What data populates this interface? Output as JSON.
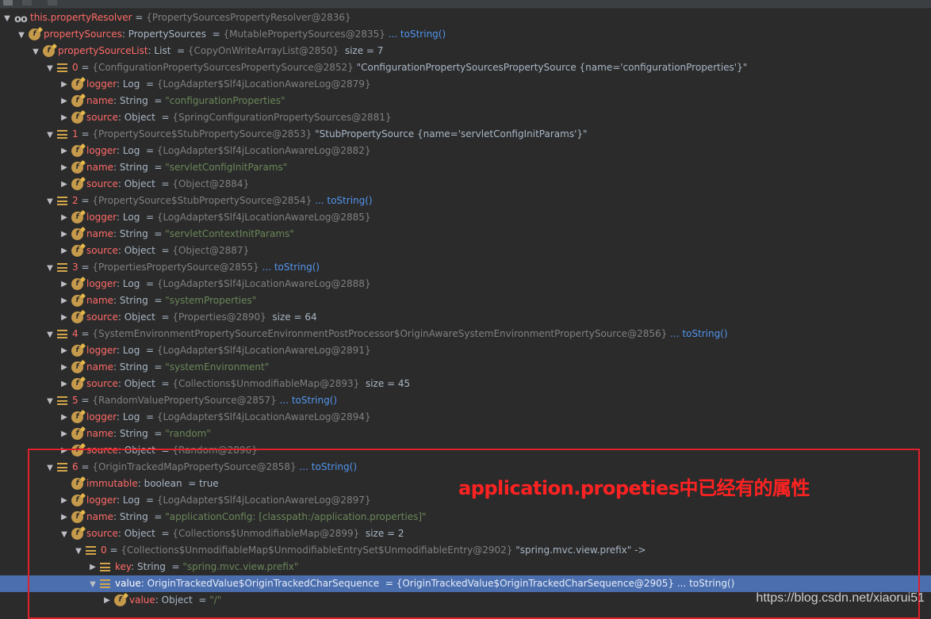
{
  "rows": [
    {
      "depth": 0,
      "tw": "exp",
      "icon": "oo",
      "name": "this.propertyResolver",
      "sep": " = ",
      "meta": "{PropertySourcesPropertyResolver@2836}"
    },
    {
      "depth": 1,
      "tw": "exp",
      "icon": "f",
      "name": "propertySources",
      "type": ": PropertySources ",
      "sep": " = ",
      "meta": "{MutablePropertySources@2835}",
      "tostr": " ... toString()"
    },
    {
      "depth": 2,
      "tw": "exp",
      "icon": "f",
      "name": "propertySourceList",
      "type": ": List ",
      "sep": " = ",
      "meta": "{CopyOnWriteArrayList@2850}",
      "extra": "  size = 7"
    },
    {
      "depth": 3,
      "tw": "exp",
      "icon": "list",
      "name": "0",
      "sep": " = ",
      "meta": "{ConfigurationPropertySourcesPropertySource@2852}",
      "extra": " \"ConfigurationPropertySourcesPropertySource {name='configurationProperties'}\""
    },
    {
      "depth": 4,
      "tw": "col",
      "icon": "f",
      "name": "logger",
      "type": ": Log ",
      "sep": " = ",
      "meta": "{LogAdapter$Slf4jLocationAwareLog@2879}"
    },
    {
      "depth": 4,
      "tw": "col",
      "icon": "f",
      "name": "name",
      "type": ": String ",
      "sep": " = ",
      "str": "\"configurationProperties\""
    },
    {
      "depth": 4,
      "tw": "col",
      "icon": "f",
      "name": "source",
      "type": ": Object ",
      "sep": " = ",
      "meta": "{SpringConfigurationPropertySources@2881}"
    },
    {
      "depth": 3,
      "tw": "exp",
      "icon": "list",
      "name": "1",
      "sep": " = ",
      "meta": "{PropertySource$StubPropertySource@2853}",
      "extra": " \"StubPropertySource {name='servletConfigInitParams'}\""
    },
    {
      "depth": 4,
      "tw": "col",
      "icon": "f",
      "name": "logger",
      "type": ": Log ",
      "sep": " = ",
      "meta": "{LogAdapter$Slf4jLocationAwareLog@2882}"
    },
    {
      "depth": 4,
      "tw": "col",
      "icon": "f",
      "name": "name",
      "type": ": String ",
      "sep": " = ",
      "str": "\"servletConfigInitParams\""
    },
    {
      "depth": 4,
      "tw": "col",
      "icon": "f",
      "name": "source",
      "type": ": Object ",
      "sep": " = ",
      "meta": "{Object@2884}"
    },
    {
      "depth": 3,
      "tw": "exp",
      "icon": "list",
      "name": "2",
      "sep": " = ",
      "meta": "{PropertySource$StubPropertySource@2854}",
      "tostr": " ... toString()"
    },
    {
      "depth": 4,
      "tw": "col",
      "icon": "f",
      "name": "logger",
      "type": ": Log ",
      "sep": " = ",
      "meta": "{LogAdapter$Slf4jLocationAwareLog@2885}"
    },
    {
      "depth": 4,
      "tw": "col",
      "icon": "f",
      "name": "name",
      "type": ": String ",
      "sep": " = ",
      "str": "\"servletContextInitParams\""
    },
    {
      "depth": 4,
      "tw": "col",
      "icon": "f",
      "name": "source",
      "type": ": Object ",
      "sep": " = ",
      "meta": "{Object@2887}"
    },
    {
      "depth": 3,
      "tw": "exp",
      "icon": "list",
      "name": "3",
      "sep": " = ",
      "meta": "{PropertiesPropertySource@2855}",
      "tostr": " ... toString()"
    },
    {
      "depth": 4,
      "tw": "col",
      "icon": "f",
      "name": "logger",
      "type": ": Log ",
      "sep": " = ",
      "meta": "{LogAdapter$Slf4jLocationAwareLog@2888}"
    },
    {
      "depth": 4,
      "tw": "col",
      "icon": "f",
      "name": "name",
      "type": ": String ",
      "sep": " = ",
      "str": "\"systemProperties\""
    },
    {
      "depth": 4,
      "tw": "col",
      "icon": "f",
      "name": "source",
      "type": ": Object ",
      "sep": " = ",
      "meta": "{Properties@2890}",
      "extra": "  size = 64"
    },
    {
      "depth": 3,
      "tw": "exp",
      "icon": "list",
      "name": "4",
      "sep": " = ",
      "meta": "{SystemEnvironmentPropertySourceEnvironmentPostProcessor$OriginAwareSystemEnvironmentPropertySource@2856}",
      "tostr": " ... toString()"
    },
    {
      "depth": 4,
      "tw": "col",
      "icon": "f",
      "name": "logger",
      "type": ": Log ",
      "sep": " = ",
      "meta": "{LogAdapter$Slf4jLocationAwareLog@2891}"
    },
    {
      "depth": 4,
      "tw": "col",
      "icon": "f",
      "name": "name",
      "type": ": String ",
      "sep": " = ",
      "str": "\"systemEnvironment\""
    },
    {
      "depth": 4,
      "tw": "col",
      "icon": "f",
      "name": "source",
      "type": ": Object ",
      "sep": " = ",
      "meta": "{Collections$UnmodifiableMap@2893}",
      "extra": "  size = 45"
    },
    {
      "depth": 3,
      "tw": "exp",
      "icon": "list",
      "name": "5",
      "sep": " = ",
      "meta": "{RandomValuePropertySource@2857}",
      "tostr": " ... toString()"
    },
    {
      "depth": 4,
      "tw": "col",
      "icon": "f",
      "name": "logger",
      "type": ": Log ",
      "sep": " = ",
      "meta": "{LogAdapter$Slf4jLocationAwareLog@2894}"
    },
    {
      "depth": 4,
      "tw": "col",
      "icon": "f",
      "name": "name",
      "type": ": String ",
      "sep": " = ",
      "str": "\"random\""
    },
    {
      "depth": 4,
      "tw": "col",
      "icon": "f",
      "name": "source",
      "type": ": Object ",
      "sep": " = ",
      "meta": "{Random@2896}"
    },
    {
      "depth": 3,
      "tw": "exp",
      "icon": "list",
      "name": "6",
      "sep": " = ",
      "meta": "{OriginTrackedMapPropertySource@2858}",
      "tostr": " ... toString()"
    },
    {
      "depth": 4,
      "tw": "none",
      "icon": "f",
      "name": "immutable",
      "type": ": boolean ",
      "sep": " = ",
      "extra": "true"
    },
    {
      "depth": 4,
      "tw": "col",
      "icon": "f",
      "name": "logger",
      "type": ": Log ",
      "sep": " = ",
      "meta": "{LogAdapter$Slf4jLocationAwareLog@2897}"
    },
    {
      "depth": 4,
      "tw": "col",
      "icon": "f",
      "name": "name",
      "type": ": String ",
      "sep": " = ",
      "str": "\"applicationConfig: [classpath:/application.properties]\""
    },
    {
      "depth": 4,
      "tw": "exp",
      "icon": "f",
      "name": "source",
      "type": ": Object ",
      "sep": " = ",
      "meta": "{Collections$UnmodifiableMap@2899}",
      "extra": "  size = 2"
    },
    {
      "depth": 5,
      "tw": "exp",
      "icon": "list",
      "name": "0",
      "sep": " = ",
      "meta": "{Collections$UnmodifiableMap$UnmodifiableEntrySet$UnmodifiableEntry@2902}",
      "extra": " \"spring.mvc.view.prefix\" ->"
    },
    {
      "depth": 6,
      "tw": "col",
      "icon": "list",
      "name": "key",
      "type": ": String ",
      "sep": " = ",
      "str": "\"spring.mvc.view.prefix\""
    },
    {
      "depth": 6,
      "tw": "exp",
      "icon": "list",
      "name": "value",
      "type": ": OriginTrackedValue$OriginTrackedCharSequence ",
      "sep": " = ",
      "meta": "{OriginTrackedValue$OriginTrackedCharSequence@2905}",
      "tostr": " ... toString()",
      "selected": true
    },
    {
      "depth": 7,
      "tw": "col",
      "icon": "f",
      "name": "value",
      "type": ": Object ",
      "sep": " = ",
      "str": "\"/\""
    }
  ],
  "annotation": "application.propeties中已经有的属性",
  "watermark": "https://blog.csdn.net/xiaorui51"
}
